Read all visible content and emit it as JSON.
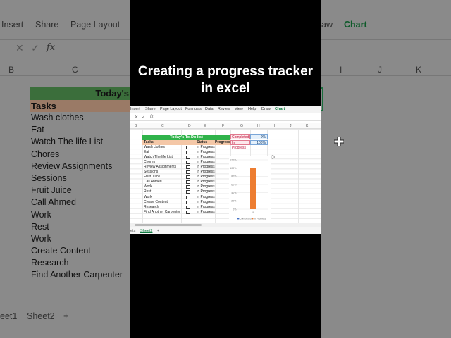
{
  "background": {
    "ribbon": [
      "Insert",
      "Share",
      "Page Layout",
      "aw",
      "Chart"
    ],
    "formula_icons": [
      "close-icon",
      "check-icon",
      "fx"
    ],
    "fx_label": "fx",
    "columns": [
      "B",
      "C",
      "I",
      "J",
      "K"
    ],
    "title": "Today's",
    "tasks_header": "Tasks",
    "tasks": [
      "Wash clothes",
      "Eat",
      "Watch The life List",
      "Chores",
      "Review Assignments",
      "Sessions",
      "Fruit Juice",
      "Call Ahmed",
      "Work",
      "Rest",
      "Work",
      "Create Content",
      "Research",
      "Find Another Carpenter"
    ],
    "sheet_tabs": [
      "eet1",
      "Sheet2",
      "+"
    ]
  },
  "caption": "Creating a progress tracker in excel",
  "inner": {
    "menu": [
      "Insert",
      "Share",
      "Page Layout",
      "Formulas",
      "Data",
      "Review",
      "View",
      "Help",
      "Draw",
      "Chart"
    ],
    "fx_label": "fx",
    "columns": [
      "B",
      "C",
      "D",
      "E",
      "F",
      "G",
      "H",
      "I",
      "J",
      "K"
    ],
    "list_title": "Today's To-Do list",
    "headers": {
      "tasks": "Tasks",
      "status": "Status",
      "progress": "Progress"
    },
    "rows": [
      {
        "task": "Wash clothes",
        "status": "In Progress"
      },
      {
        "task": "Eat",
        "status": "In Progress"
      },
      {
        "task": "Watch The life List",
        "status": "In Progress"
      },
      {
        "task": "Chores",
        "status": "In Progress"
      },
      {
        "task": "Review Assignments",
        "status": "In Progress"
      },
      {
        "task": "Sessions",
        "status": "In Progress"
      },
      {
        "task": "Fruit Juice",
        "status": "In Progress"
      },
      {
        "task": "Call Ahmed",
        "status": "In Progress"
      },
      {
        "task": "Work",
        "status": "In Progress"
      },
      {
        "task": "Rest",
        "status": "In Progress"
      },
      {
        "task": "Work",
        "status": "In Progress"
      },
      {
        "task": "Create Content",
        "status": "In Progress"
      },
      {
        "task": "Research",
        "status": "In Progress"
      },
      {
        "task": "Find Another Carpenter",
        "status": "In Progress"
      }
    ],
    "stats": [
      {
        "label": "Completed",
        "value": "0%"
      },
      {
        "label": "In Progress",
        "value": "100%"
      }
    ],
    "sheet_tabs": [
      "ets",
      "Sheet2",
      "+"
    ]
  },
  "chart_data": {
    "type": "bar",
    "categories": [
      "1"
    ],
    "series": [
      {
        "name": "Completed",
        "values": [
          0
        ],
        "color": "#4472c4"
      },
      {
        "name": "In Progress",
        "values": [
          100
        ],
        "color": "#ed7d31"
      }
    ],
    "yticks": [
      "0%",
      "20%",
      "40%",
      "60%",
      "80%",
      "100%",
      "120%"
    ],
    "ylim": [
      0,
      120
    ],
    "legend": "bottom"
  }
}
